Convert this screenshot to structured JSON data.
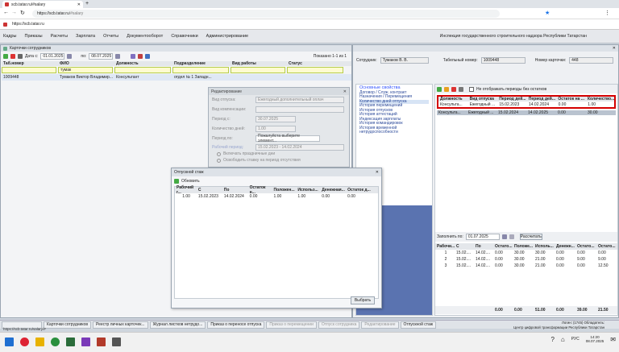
{
  "browser": {
    "tab_title": "scb.tatar.ru/#salary",
    "tab2_title": "scb.tatar.ru/#salary",
    "address": "https://scb.tatar.ru",
    "address_path": "/#salary",
    "bookmark": "https://scb.tatar.ru"
  },
  "menu": {
    "items": [
      "Кадры",
      "Приказы",
      "Расчеты",
      "Зарплата",
      "Отчеты",
      "Документооборот",
      "Справочники",
      "Администрирование"
    ],
    "org": "Инспекция государственного строительного надзора Республики Татарстан"
  },
  "list": {
    "title": "Карточки сотрудников",
    "date_from_label": "Дата с:",
    "date_from": "01.01.2025",
    "date_to_label": "по:",
    "date_to": "08.07.2025",
    "shown": "Показано 1-1 из 1",
    "headers": [
      "Таб.номер",
      "ФИО",
      "Должность",
      "Подразделение",
      "Вид работы",
      "Статус"
    ],
    "filter_fio": "тумак",
    "row": [
      "1009448",
      "Тумаков Виктор Владимир...",
      "Консультант",
      "отдел № 1 Западн..."
    ]
  },
  "employee": {
    "label": "Сотрудник:",
    "name": "Тумаков В. В.",
    "tab_label": "Табельный номер:",
    "tab_no": "1009448",
    "card_label": "Номер карточки:",
    "card_no": "448"
  },
  "nav": [
    "Основные свойства",
    "Договор / Служ. контракт",
    "Назначения / Перемещения",
    "Количество дней отпуска",
    "История перемещений",
    "История отпусков",
    "История аттестаций",
    "Индексация зарплаты",
    "История командировок",
    "История временной нетрудоспособности"
  ],
  "vac": {
    "checkbox": "Не отображать периоды без остатков",
    "headers": [
      "Должность",
      "Вид отпуска",
      "Период дей...",
      "Период дей...",
      "Остаток на ...",
      "Количество..."
    ],
    "rows": [
      [
        "Консульта...",
        "Ежегодный ...",
        "15.02.2023",
        "14.02.2024",
        "0.00",
        "1.00"
      ],
      [
        "Консульта...",
        "Ежегодный ...",
        "15.02.2024",
        "14.02.2025",
        "0.00",
        "30.00"
      ]
    ],
    "fill_label": "Заполнить по:",
    "fill_date": "01.07.2025",
    "fill_btn": "Рассчитать",
    "sub_headers": [
      "Рабочи...",
      "С",
      "По",
      "Остато...",
      "Положе...",
      "Исполь...",
      "Денежн...",
      "Остато...",
      "Остато..."
    ],
    "sub_rows": [
      [
        "1",
        "15.02....",
        "14.02....",
        "0.00",
        "30.00",
        "30.00",
        "0.00",
        "0.00",
        "0.00"
      ],
      [
        "2",
        "15.02....",
        "14.02....",
        "0.00",
        "30.00",
        "21.00",
        "0.00",
        "9.00",
        "9.00"
      ],
      [
        "3",
        "15.02....",
        "14.02....",
        "0.00",
        "30.00",
        "21.00",
        "0.00",
        "0.00",
        "12.50"
      ]
    ],
    "totals": [
      "0.00",
      "0.00",
      "51.00",
      "0.00",
      "39.00",
      "21.50"
    ]
  },
  "edit": {
    "title": "Редактирование",
    "fields": [
      [
        "Вид отпуска:",
        "Ежегодный дополнительный оплач"
      ],
      [
        "Вид компенсации:",
        ""
      ],
      [
        "Период с:",
        "30.07.2025"
      ],
      [
        "Количество дней:",
        "1.00"
      ],
      [
        "Период по:",
        "Пожалуйста выберите элемент..."
      ],
      [
        "Рабочий период:",
        "15.02.2023 - 14.02.2024"
      ]
    ],
    "cb1": "Включать праздничные дни",
    "cb2": "Освободить ставку на период отсутствия"
  },
  "stage": {
    "title": "Отпускной стаж",
    "refresh": "Обновить",
    "headers": [
      "Рабочий г...",
      "С",
      "По",
      "Остаток н...",
      "Положен...",
      "Использ...",
      "Денежная...",
      "Остаток д..."
    ],
    "row": [
      "1.00",
      "15.02.2023",
      "14.02.2024",
      "0.00",
      "1.00",
      "1.00",
      "0.00",
      "0.00"
    ],
    "select_btn": "Выбрать"
  },
  "taskbar": [
    "Карточки сотрудников",
    "Реестр личных карточек...",
    "Журнал листков нетрудо...",
    "Приказ о переносе отпуска",
    "Приказ о перемещении",
    "Отпуск сотрудника",
    "Редактирование",
    "Отпускной стаж"
  ],
  "status": {
    "url": "https://scb.tatar.ru/salary/#",
    "login": "Логин: (1745) Обладатель:",
    "center": "Центр цифровой трансформации Республики Татарстан"
  },
  "clock": {
    "time": "14:20",
    "date": "08.07.2025",
    "lang": "РУС"
  }
}
